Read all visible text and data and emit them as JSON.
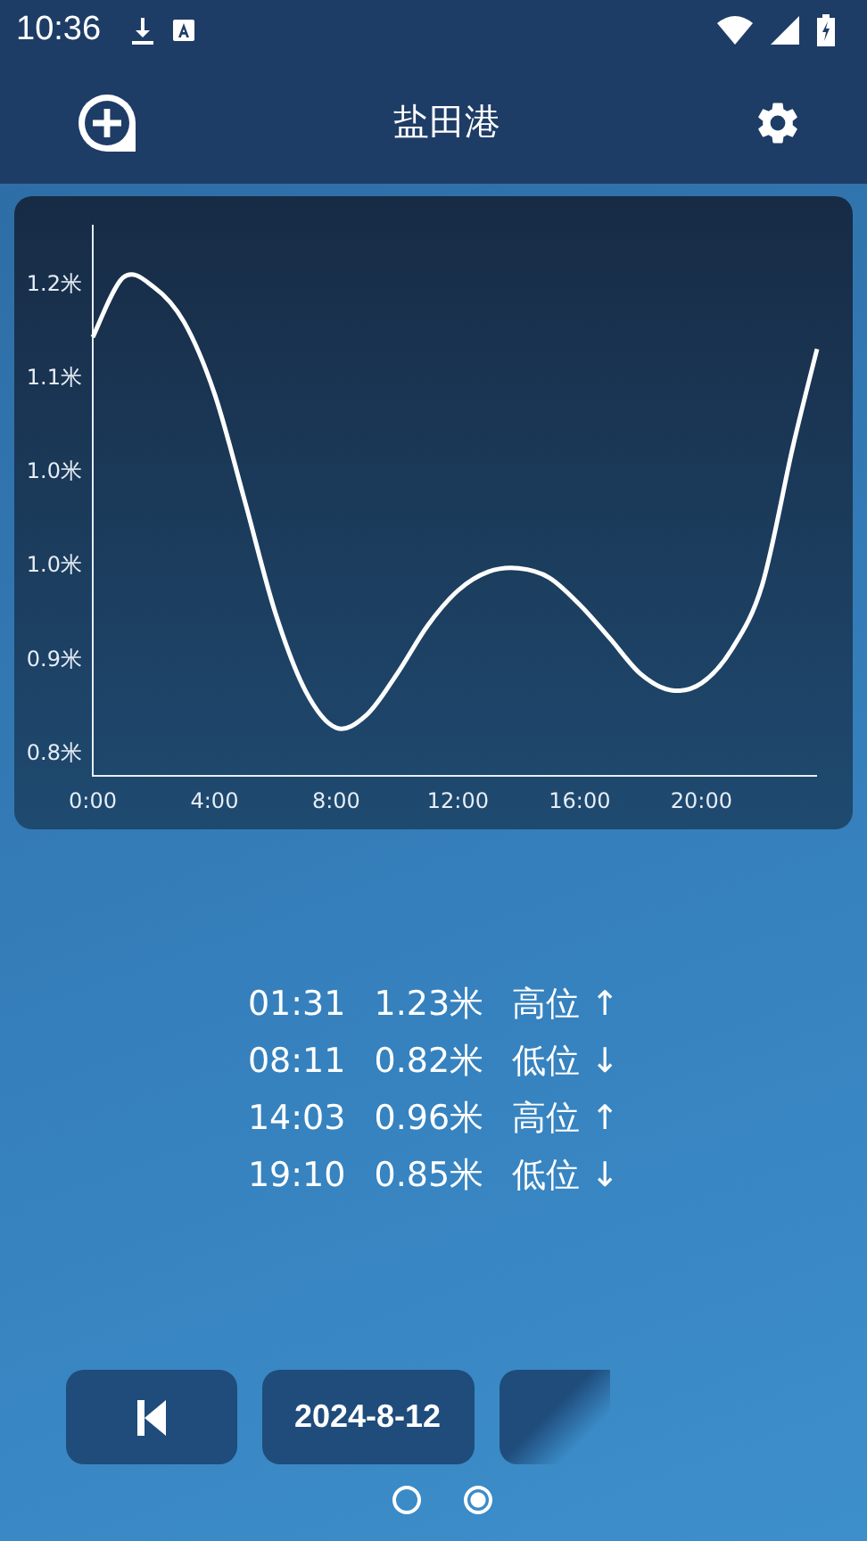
{
  "status_bar": {
    "time": "10:36"
  },
  "app_bar": {
    "title": "盐田港"
  },
  "chart": {
    "chart_data": {
      "type": "line",
      "x": [
        0,
        1,
        2,
        3,
        4,
        5,
        6,
        7,
        8,
        9,
        10,
        11,
        12,
        13,
        14,
        15,
        16,
        17,
        18,
        19,
        20,
        21,
        22,
        23,
        23.8
      ],
      "series": [
        {
          "color": "#ffffff",
          "values": [
            1.154,
            1.205,
            1.197,
            1.167,
            1.106,
            1.014,
            0.919,
            0.852,
            0.821,
            0.832,
            0.867,
            0.908,
            0.938,
            0.954,
            0.957,
            0.949,
            0.926,
            0.897,
            0.867,
            0.853,
            0.859,
            0.888,
            0.943,
            1.06,
            1.144
          ]
        }
      ],
      "xlim": [
        0,
        23.8
      ],
      "ylim": [
        0.78,
        1.25
      ],
      "xticks": [
        {
          "value": 0,
          "label": "0:00"
        },
        {
          "value": 4,
          "label": "4:00"
        },
        {
          "value": 8,
          "label": "8:00"
        },
        {
          "value": 12,
          "label": "12:00"
        },
        {
          "value": 16,
          "label": "16:00"
        },
        {
          "value": 20,
          "label": "20:00"
        }
      ],
      "yticks": [
        {
          "value": 0.8,
          "label": "0.8米"
        },
        {
          "value": 0.88,
          "label": "0.9米"
        },
        {
          "value": 0.96,
          "label": "1.0米"
        },
        {
          "value": 1.04,
          "label": "1.0米"
        },
        {
          "value": 1.12,
          "label": "1.1米"
        },
        {
          "value": 1.2,
          "label": "1.2米"
        }
      ]
    }
  },
  "tides": [
    {
      "time": "01:31",
      "height": "1.23米",
      "type": "高位 ↑"
    },
    {
      "time": "08:11",
      "height": "0.82米",
      "type": "低位 ↓"
    },
    {
      "time": "14:03",
      "height": "0.96米",
      "type": "高位 ↑"
    },
    {
      "time": "19:10",
      "height": "0.85米",
      "type": "低位 ↓"
    }
  ],
  "date_button": "2024-8-12",
  "pages": [
    {
      "selected": false
    },
    {
      "selected": true
    }
  ]
}
